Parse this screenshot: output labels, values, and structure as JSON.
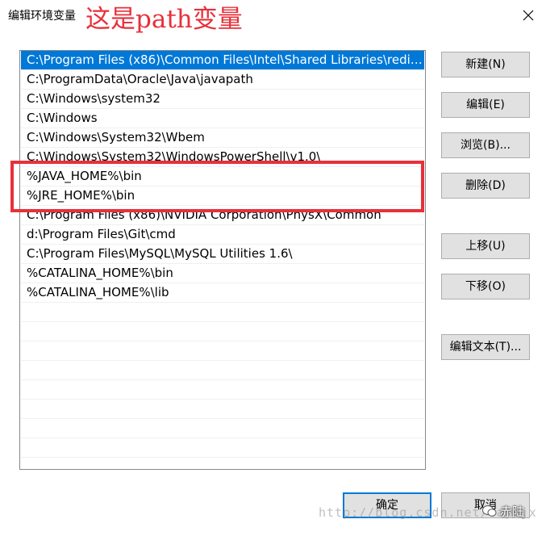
{
  "window": {
    "title": "编辑环境变量",
    "annotation": "这是path变量"
  },
  "path_list": {
    "items": [
      "C:\\Program Files (x86)\\Common Files\\Intel\\Shared Libraries\\redist...",
      "C:\\ProgramData\\Oracle\\Java\\javapath",
      "C:\\Windows\\system32",
      "C:\\Windows",
      "C:\\Windows\\System32\\Wbem",
      "C:\\Windows\\System32\\WindowsPowerShell\\v1.0\\",
      "%JAVA_HOME%\\bin",
      "%JRE_HOME%\\bin",
      "C:\\Program Files (x86)\\NVIDIA Corporation\\PhysX\\Common",
      "d:\\Program Files\\Git\\cmd",
      "C:\\Program Files\\MySQL\\MySQL Utilities 1.6\\",
      "%CATALINA_HOME%\\bin",
      "%CATALINA_HOME%\\lib"
    ],
    "selected_index": 0
  },
  "buttons": {
    "new": "新建(N)",
    "edit": "编辑(E)",
    "browse": "浏览(B)...",
    "delete": "删除(D)",
    "move_up": "上移(U)",
    "move_down": "下移(O)",
    "edit_text": "编辑文本(T)...",
    "ok": "确定",
    "cancel": "取消"
  },
  "watermark": "http://blog.csdn.net/carejx",
  "wechat_badge": "赤陆",
  "colors": {
    "selection": "#0078d7",
    "annotation_red": "#e8303a"
  }
}
